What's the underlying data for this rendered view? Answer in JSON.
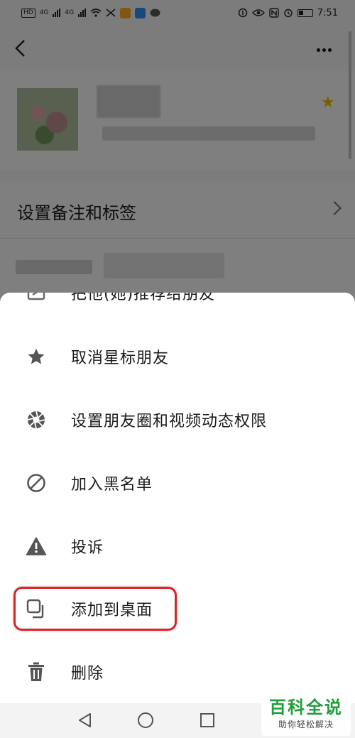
{
  "status_bar": {
    "left_chips": [
      "HD",
      "4G",
      "4G"
    ],
    "time": "7:51"
  },
  "profile": {
    "remark_label": "设置备注和标签"
  },
  "sheet": {
    "items": [
      {
        "label": "把他(她)推荐给朋友",
        "icon": "share-card-icon"
      },
      {
        "label": "取消星标朋友",
        "icon": "star-icon"
      },
      {
        "label": "设置朋友圈和视频动态权限",
        "icon": "aperture-icon"
      },
      {
        "label": "加入黑名单",
        "icon": "block-icon"
      },
      {
        "label": "投诉",
        "icon": "warning-icon"
      },
      {
        "label": "添加到桌面",
        "icon": "add-to-desktop-icon"
      },
      {
        "label": "删除",
        "icon": "trash-icon"
      }
    ]
  },
  "watermark": {
    "title": "百科全说",
    "subtitle": "助你轻松解决"
  },
  "colors": {
    "highlight": "#d4262a",
    "watermark_green": "#1e9e39",
    "star": "#e7b400"
  }
}
